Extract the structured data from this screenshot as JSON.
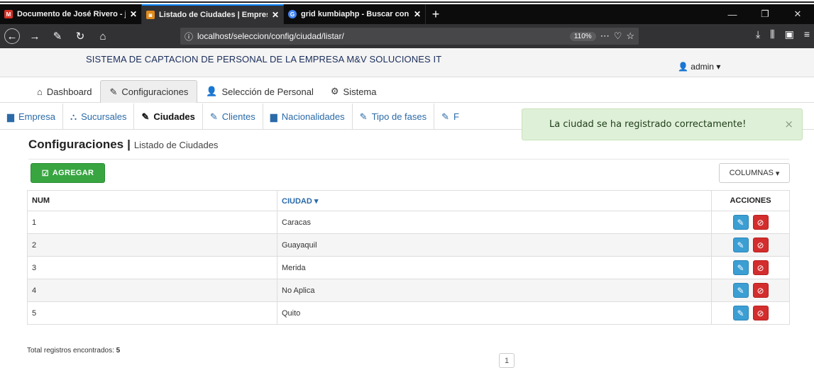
{
  "browser": {
    "tabs": [
      {
        "title": "Documento de José Rivero - jri",
        "favicon_color": "#d93025",
        "active": false
      },
      {
        "title": "Listado de Ciudades | Empresa",
        "favicon_color": "#e08a1b",
        "active": true
      },
      {
        "title": "grid kumbiaphp - Buscar con G",
        "favicon_color": "#4285f4",
        "active": false
      }
    ],
    "url": "localhost/seleccion/config/ciudad/listar/",
    "zoom": "110%"
  },
  "app": {
    "title": "SISTEMA DE CAPTACION DE PERSONAL DE LA EMPRESA M&V SOLUCIONES IT",
    "user": "admin"
  },
  "main_nav": [
    {
      "label": "Dashboard",
      "icon": "home-icon"
    },
    {
      "label": "Configuraciones",
      "icon": "wrench-icon",
      "active": true
    },
    {
      "label": "Selección de Personal",
      "icon": "user-icon"
    },
    {
      "label": "Sistema",
      "icon": "gears-icon"
    }
  ],
  "sub_nav": [
    {
      "label": "Empresa",
      "icon": "briefcase-icon"
    },
    {
      "label": "Sucursales",
      "icon": "sitemap-icon"
    },
    {
      "label": "Ciudades",
      "icon": "wrench-icon",
      "active": true
    },
    {
      "label": "Clientes",
      "icon": "wrench-icon"
    },
    {
      "label": "Nacionalidades",
      "icon": "briefcase-icon"
    },
    {
      "label": "Tipo de fases",
      "icon": "wrench-icon"
    },
    {
      "label": "F",
      "icon": "wrench-icon"
    }
  ],
  "alert": {
    "message": "La ciudad se ha registrado correctamente!",
    "close": "×"
  },
  "page": {
    "heading": "Configuraciones",
    "separator": "|",
    "subheading": "Listado de Ciudades",
    "add_button": "AGREGAR",
    "columns_button": "COLUMNAS"
  },
  "table": {
    "headers": [
      "NUM",
      "CIUDAD",
      "ACCIONES"
    ],
    "rows": [
      {
        "num": "1",
        "ciudad": "Caracas"
      },
      {
        "num": "2",
        "ciudad": "Guayaquil"
      },
      {
        "num": "3",
        "ciudad": "Merida"
      },
      {
        "num": "4",
        "ciudad": "No Aplica"
      },
      {
        "num": "5",
        "ciudad": "Quito"
      }
    ]
  },
  "footer": {
    "total_label": "Total registros encontrados:",
    "total_value": "5",
    "page": "1"
  }
}
